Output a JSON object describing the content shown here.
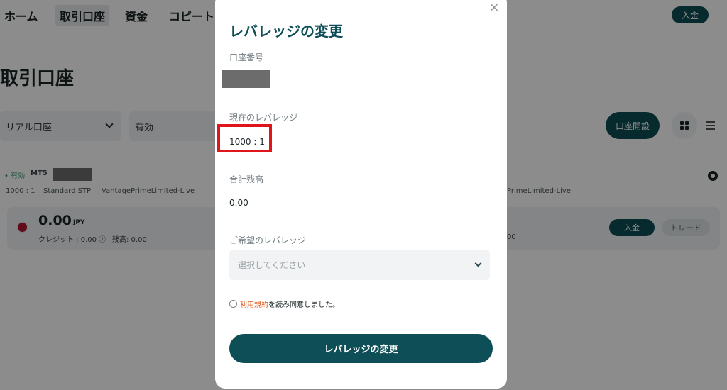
{
  "nav": {
    "items": [
      {
        "label": "ホーム"
      },
      {
        "label": "取引口座"
      },
      {
        "label": "資金"
      },
      {
        "label": "コピート"
      }
    ],
    "deposit_label": "入金"
  },
  "page": {
    "title": "取引口座",
    "filters": {
      "account_type": "リアル口座",
      "status": "有効"
    },
    "open_account_label": "口座開設"
  },
  "account": {
    "status_badge": "• 有効",
    "platform": "MT5",
    "leverage": "1000 : 1",
    "account_type": "Standard STP",
    "server": "VantagePrimeLimited-Live",
    "server_partial": "PrimeLimited-Live",
    "balance": "0.00",
    "currency": "JPY",
    "credit": "クレジット : 0.00 ⓘ",
    "remaining": "残高:  0.00",
    "remaining_partial": "00",
    "deposit_label": "入金",
    "trade_label": "トレード"
  },
  "modal": {
    "close_symbol": "×",
    "title": "レバレッジの変更",
    "account_number_label": "口座番号",
    "current_leverage_label": "現在のレバレッジ",
    "current_leverage_value": "1000 : 1",
    "total_balance_label": "合計残高",
    "total_balance_value": "0.00",
    "desired_leverage_label": "ご希望のレバレッジ",
    "select_placeholder": "選択してください",
    "terms_link": "利用規約",
    "terms_text": "を読み同意しました。",
    "submit_label": "レバレッジの変更"
  },
  "colors": {
    "brand": "#0d4e57",
    "highlight": "#e0151c",
    "link": "#e05a1c"
  }
}
